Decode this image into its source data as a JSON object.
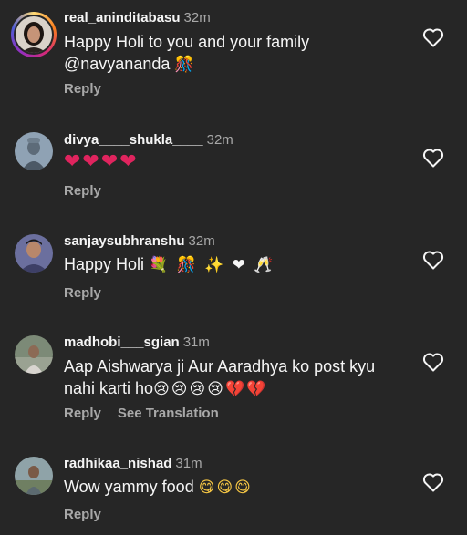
{
  "comments": [
    {
      "username": "real_aninditabasu",
      "time": "32m",
      "text": "Happy Holi to you and your family @navyananda",
      "emoji": "🎊",
      "reply": "Reply"
    },
    {
      "username": "divya____shukla____",
      "time": "32m",
      "emoji": "❤❤❤❤",
      "reply": "Reply"
    },
    {
      "username": "sanjaysubhranshu",
      "time": "32m",
      "text": "Happy Holi",
      "emoji": "💐 🎊 ✨ ❤ 🥂",
      "reply": "Reply"
    },
    {
      "username": "madhobi___sgian",
      "time": "31m",
      "text": "Aap Aishwarya ji Aur Aaradhya ko post kyu nahi karti ho",
      "emoji": "😢😢😢😢💔💔",
      "reply": "Reply",
      "see_translation": "See Translation"
    },
    {
      "username": "radhikaa_nishad",
      "time": "31m",
      "text": "Wow yammy food",
      "emoji": "😋😋😋",
      "reply": "Reply"
    }
  ],
  "icons": {
    "like": "heart-outline-icon"
  },
  "colors": {
    "background": "#262626",
    "text": "#f5f5f5",
    "muted": "#a8a8a8",
    "red": "#e0245e"
  }
}
